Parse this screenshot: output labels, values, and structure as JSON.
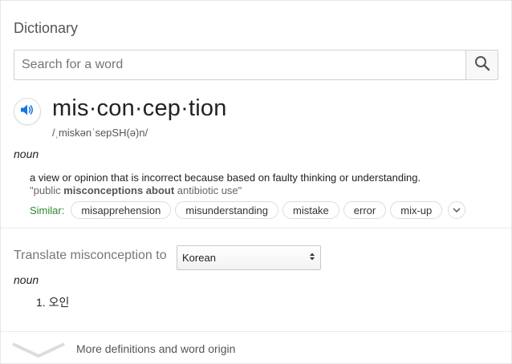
{
  "title": "Dictionary",
  "search": {
    "placeholder": "Search for a word",
    "value": "",
    "button_icon": "search-icon"
  },
  "entry": {
    "speaker_icon": "speaker-icon",
    "headword": "mis·con·cep·tion",
    "phonetic": "/ˌmiskənˈsepSH(ə)n/",
    "part_of_speech": "noun",
    "definition": "a view or opinion that is incorrect because based on faulty thinking or understanding.",
    "example": {
      "open": "\"public ",
      "bold": "misconceptions about",
      "close": " antibiotic use\""
    },
    "similar_label": "Similar:",
    "similar": [
      "misapprehension",
      "misunderstanding",
      "mistake",
      "error",
      "mix-up"
    ],
    "expand_icon": "chevron-down-icon"
  },
  "translate": {
    "label": "Translate misconception to",
    "selected_language": "Korean",
    "part_of_speech": "noun",
    "results": [
      "1. 오인"
    ]
  },
  "footer": {
    "more_label": "More definitions and word origin",
    "icon": "chevron-down-icon"
  },
  "colors": {
    "accent_blue": "#1a73e8",
    "similar_green": "#2a8a2a",
    "border": "#dadce0"
  }
}
